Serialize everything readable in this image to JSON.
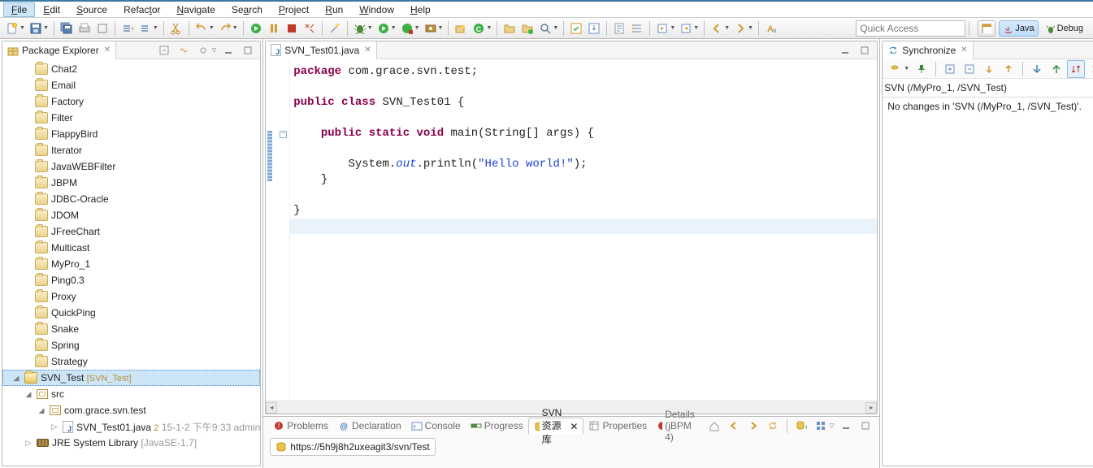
{
  "menu": {
    "items": [
      {
        "label": "File",
        "u": "F",
        "sel": true
      },
      {
        "label": "Edit",
        "u": "E"
      },
      {
        "label": "Source",
        "u": "S"
      },
      {
        "label": "Refactor",
        "u": "t"
      },
      {
        "label": "Navigate",
        "u": "N"
      },
      {
        "label": "Search",
        "u": "a"
      },
      {
        "label": "Project",
        "u": "P"
      },
      {
        "label": "Run",
        "u": "R"
      },
      {
        "label": "Window",
        "u": "W"
      },
      {
        "label": "Help",
        "u": "H"
      }
    ]
  },
  "toolbar": {
    "quick_placeholder": "Quick Access"
  },
  "perspectives": {
    "java": "Java",
    "debug": "Debug"
  },
  "pkg_explorer": {
    "title": "Package Explorer",
    "folders": [
      "Chat2",
      "Email",
      "Factory",
      "Filter",
      "FlappyBird",
      "Iterator",
      "JavaWEBFilter",
      "JBPM",
      "JDBC-Oracle",
      "JDOM",
      "JFreeChart",
      "Multicast",
      "MyPro_1",
      "Ping0.3",
      "Proxy",
      "QuickPing",
      "Snake",
      "Spring",
      "Strategy"
    ],
    "project": {
      "name": "SVN_Test",
      "repo": "[SVN_Test]",
      "src": "src",
      "pkg": "com.grace.svn.test",
      "file": {
        "name": "SVN_Test01.java",
        "rev": "2",
        "date": "15-1-2 下午9:33",
        "author": "admin"
      },
      "lib": "JRE System Library",
      "lib_env": "[JavaSE-1.7]"
    }
  },
  "editor": {
    "tab": "SVN_Test01.java",
    "code": {
      "l1_kw": "package",
      "l1_rest": " com.grace.svn.test;",
      "l3a": "public",
      "l3b": " class",
      "l3c": " SVN_Test01 {",
      "l5a": "public",
      "l5b": " static",
      "l5c": " void",
      "l5d": " main(String[] args) {",
      "l7a": "        System.",
      "l7b": "out",
      "l7c": ".println(",
      "l7d": "\"Hello world!\"",
      "l7e": ");",
      "l8": "    }",
      "l10": "}"
    }
  },
  "sync": {
    "title": "Synchronize",
    "header": "SVN (/MyPro_1, /SVN_Test)",
    "msg": "No changes in 'SVN (/MyPro_1, /SVN_Test)'."
  },
  "bottom_tabs": {
    "problems": "Problems",
    "declaration": "Declaration",
    "console": "Console",
    "progress": "Progress",
    "svn": "SVN 资源库",
    "properties": "Properties",
    "details": "Details (jBPM 4)"
  },
  "repo_url": "https://5h9j8h2uxeagit3/svn/Test"
}
